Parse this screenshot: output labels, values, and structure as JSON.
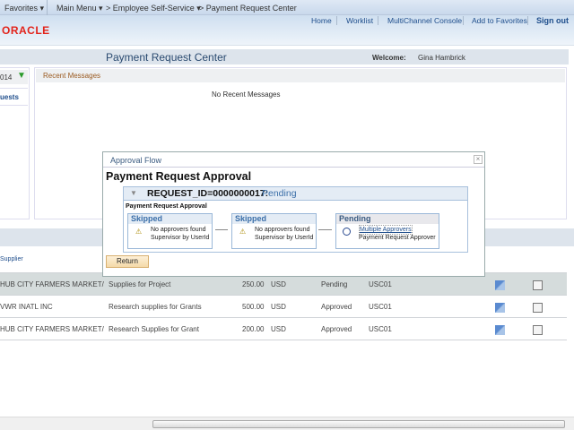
{
  "nav": {
    "favorites": "Favorites ▾",
    "main_menu": "Main Menu ▾",
    "crumb1": "> Employee Self-Service ▾",
    "crumb2": "> Payment Request Center"
  },
  "header_links": [
    "Home",
    "Worklist",
    "MultiChannel Console",
    "Add to Favorites",
    "Sign out"
  ],
  "logo": "ORACLE",
  "page": {
    "title": "Payment Request Center",
    "welcome_label": "Welcome:",
    "user": "Gina Hambrick"
  },
  "left_panel": {
    "date_fragment": "014",
    "link_fragment": "uests"
  },
  "recent": {
    "title": "Recent Messages",
    "empty": "No Recent Messages"
  },
  "table": {
    "header_supplier": "Supplier",
    "rows": [
      {
        "supplier": "HUB CITY FARMERS MARKET/",
        "description": "Supplies for Project",
        "amount": "250.00",
        "currency": "USD",
        "status": "Pending",
        "bu": "USC01"
      },
      {
        "supplier": "VWR INATL INC",
        "description": "Research supplies for Grants",
        "amount": "500.00",
        "currency": "USD",
        "status": "Approved",
        "bu": "USC01"
      },
      {
        "supplier": "HUB CITY FARMERS MARKET/",
        "description": "Research Supplies for Grant",
        "amount": "200.00",
        "currency": "USD",
        "status": "Approved",
        "bu": "USC01"
      }
    ]
  },
  "modal": {
    "title": "Approval Flow",
    "close": "×",
    "heading": "Payment Request Approval",
    "request_id": "REQUEST_ID=0000000017:",
    "request_status": "Pending",
    "subtitle": "Payment Request Approval",
    "steps": [
      {
        "status": "Skipped",
        "line1": "No approvers found",
        "line2": "Supervisor by UserId",
        "icon": "user-warning-icon"
      },
      {
        "status": "Skipped",
        "line1": "No approvers found",
        "line2": "Supervisor by UserId",
        "icon": "user-warning-icon"
      },
      {
        "status": "Pending",
        "line1": "Multiple Approvers",
        "line2": "Payment Request Approver",
        "icon": "clock-icon"
      }
    ],
    "return": "Return"
  },
  "colors": {
    "accent": "#1f4e8c",
    "oracle_red": "#e2231a",
    "highlight_row": "#d5dcdc"
  }
}
